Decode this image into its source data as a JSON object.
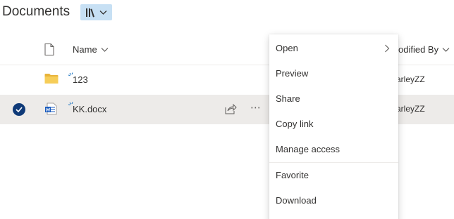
{
  "header": {
    "title": "Documents",
    "view_switch_icon": "library-icon"
  },
  "columns": {
    "name": "Name",
    "modified_by": "odified By"
  },
  "rows": [
    {
      "name": "123",
      "type": "folder",
      "modified_by": "arleyZZ",
      "selected": false
    },
    {
      "name": "KK.docx",
      "type": "word-document",
      "modified_by": "arleyZZ",
      "selected": true
    }
  ],
  "context_menu": {
    "items": [
      {
        "label": "Open",
        "has_submenu": true
      },
      {
        "label": "Preview"
      },
      {
        "label": "Share"
      },
      {
        "label": "Copy link"
      },
      {
        "label": "Manage access",
        "highlighted": true
      },
      {
        "label": "Favorite"
      },
      {
        "label": "Download"
      }
    ]
  },
  "colors": {
    "accent": "#0f3a78",
    "view_switch_bg": "#c7e0f4",
    "selected_row_bg": "#edebe9",
    "highlight": "#ffff22",
    "folder": "#f2c94c",
    "word_blue": "#185abd"
  }
}
